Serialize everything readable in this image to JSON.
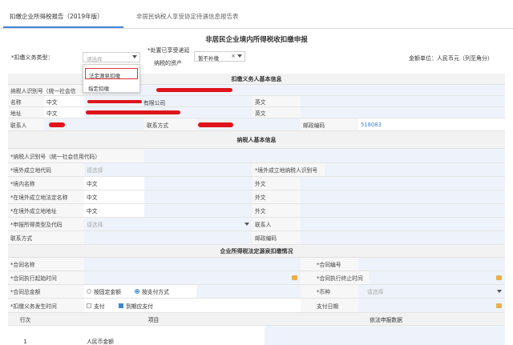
{
  "tabs": [
    {
      "label": "扣缴企业所得税报告（2019年版）"
    },
    {
      "label": "非居民纳税人享受协定待遇信息报告表"
    }
  ],
  "page_title": "非居民企业境内所得税收扣缴申报",
  "options": {
    "withholding_type_label": "*扣缴义务类型：",
    "withholding_type_placeholder": "请选择",
    "enjoy_label_line1": "*处置已享受递延",
    "enjoy_label_line2": "纳税的资产",
    "enjoy_value": "暂不补缴",
    "clear_mark": "×",
    "currency_unit": "金额单位：人民币元（列至角分）"
  },
  "dropdown": {
    "items": [
      "法定源泉扣缴",
      "指定扣缴"
    ]
  },
  "section_withholder": "扣缴义务人基本信息",
  "withholder": {
    "tax_id_label": "纳税人识别号（统一社会信",
    "name_label": "名称",
    "name_lang": "中文",
    "name_suffix": "有限公司",
    "name_en_label": "英文",
    "address_label": "地址",
    "address_lang": "中文",
    "address_en_label": "英文",
    "contact_label": "联系人",
    "phone_label": "联系方式",
    "postcode_label": "邮政编码",
    "postcode_value": "518083"
  },
  "section_taxpayer": "纳税人基本信息",
  "taxpayer": {
    "tax_id_label": "*纳税人识别号（统一社会信用代码）",
    "overseas_code_label": "*境外成立地代码",
    "overseas_code_placeholder": "请选择",
    "overseas_taxid_label": "*境外成立地纳税人识别号",
    "name_label": "*境内名称",
    "name_lang": "中文",
    "name_en_label": "外文",
    "overseas_name_label": "*在境外成立地法定名称",
    "overseas_name_lang": "中文",
    "overseas_name_en_label": "外文",
    "overseas_addr_label": "*在境外成立地地址",
    "overseas_addr_lang": "中文",
    "overseas_addr_en_label": "外文",
    "income_type_label": "*申报所得类型及代码",
    "income_type_placeholder": "请选择",
    "contact_label": "联系人",
    "phone_label": "联系方式",
    "postcode_label": "邮政编码"
  },
  "section_contract": "企业所得税法定源泉扣缴情况",
  "contract": {
    "name_label": "*合同名称",
    "number_label": "*合同编号",
    "start_label": "*合同执行起始时间",
    "end_label": "*合同执行终止时间",
    "total_label": "*合同总金额",
    "radio1": "按固定金额",
    "radio2": "按支付方式",
    "currency_label": "*币种",
    "currency_placeholder": "请选择",
    "obligation_label": "*扣缴义务发生时间",
    "check1": "支付",
    "check2": "到期应支付",
    "pay_date_label": "支付日期"
  },
  "bottom": {
    "col1": "行次",
    "col2": "项目",
    "col3": "依法申报数据",
    "row1_num": "1",
    "row1_item": "人民币金额"
  }
}
